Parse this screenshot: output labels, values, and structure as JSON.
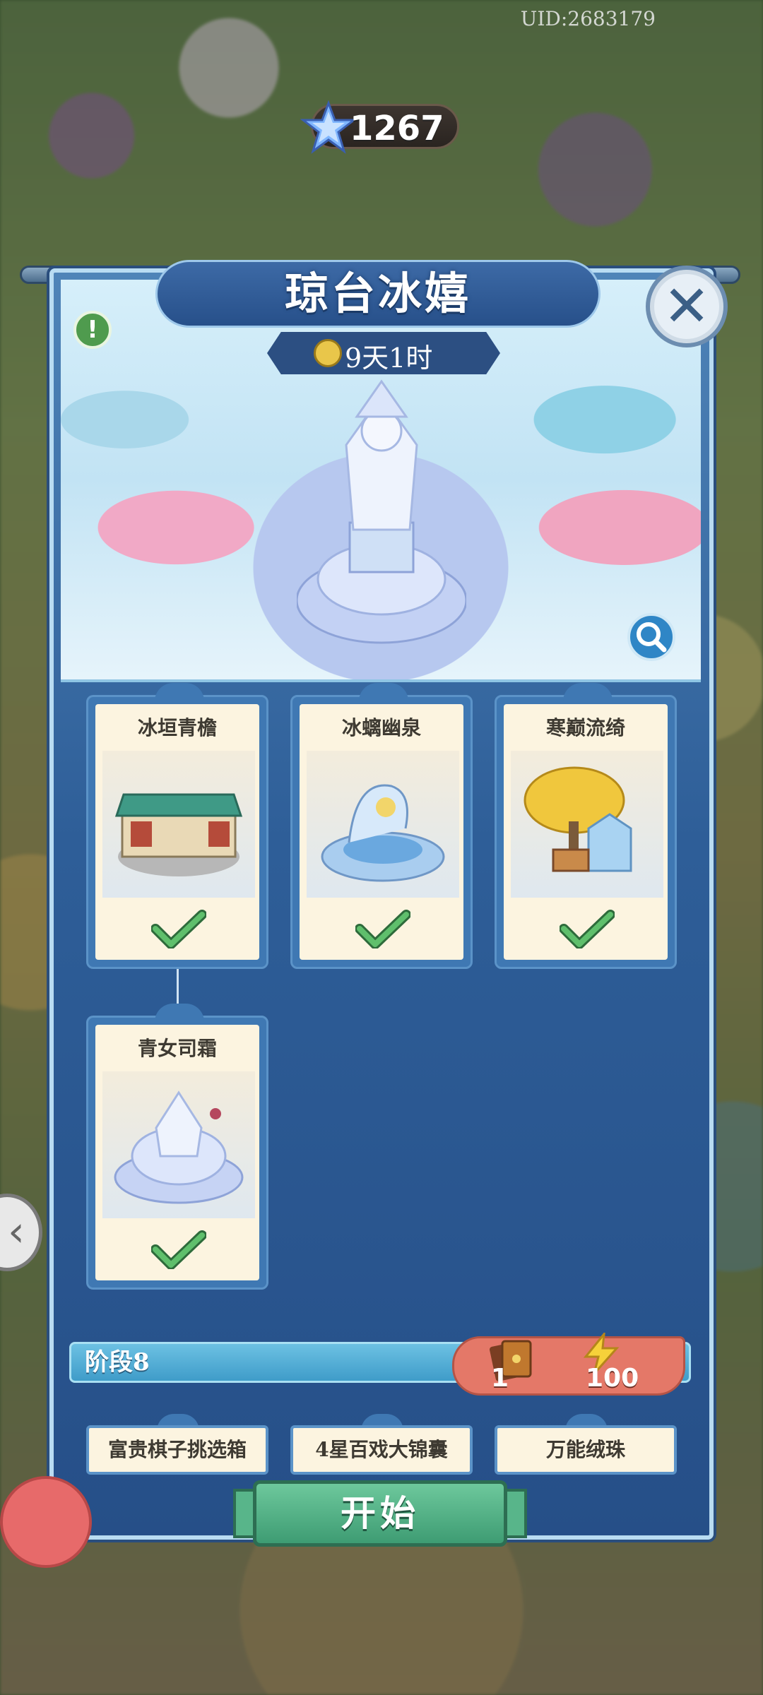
{
  "header": {
    "uid": "UID:2683179",
    "currency_amount": "1267",
    "currency_icon": "blue-star-icon"
  },
  "event": {
    "title": "琼台冰嬉",
    "timer": "9天1时"
  },
  "cards": [
    {
      "name": "冰垣青檐",
      "completed": true
    },
    {
      "name": "冰螭幽泉",
      "completed": true
    },
    {
      "name": "寒巅流绮",
      "completed": true
    },
    {
      "name": "青女司霜",
      "completed": true
    }
  ],
  "stage": {
    "label": "阶段8",
    "cost_items": [
      {
        "icon": "ticket-cards-icon",
        "amount": "1"
      },
      {
        "icon": "lightning-icon",
        "amount": "100"
      }
    ]
  },
  "rewards": [
    "富贵棋子挑选箱",
    "4星百戏大锦囊",
    "万能绒珠"
  ],
  "start_button": "开始",
  "colors": {
    "panel": "#2e5e98",
    "card_bg": "#fcf4e0",
    "check": "#4fa05a",
    "stage_bar": "#3f9cc9",
    "cost_box": "#e47868",
    "start": "#3e9c73"
  }
}
